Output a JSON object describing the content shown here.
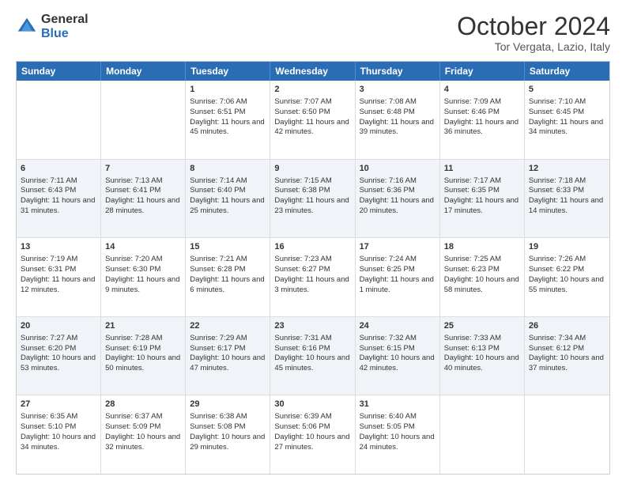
{
  "header": {
    "logo_line1": "General",
    "logo_line2": "Blue",
    "month": "October 2024",
    "location": "Tor Vergata, Lazio, Italy"
  },
  "weekdays": [
    "Sunday",
    "Monday",
    "Tuesday",
    "Wednesday",
    "Thursday",
    "Friday",
    "Saturday"
  ],
  "rows": [
    {
      "alt": false,
      "cells": [
        {
          "day": "",
          "content": ""
        },
        {
          "day": "",
          "content": ""
        },
        {
          "day": "1",
          "content": "Sunrise: 7:06 AM\nSunset: 6:51 PM\nDaylight: 11 hours and 45 minutes."
        },
        {
          "day": "2",
          "content": "Sunrise: 7:07 AM\nSunset: 6:50 PM\nDaylight: 11 hours and 42 minutes."
        },
        {
          "day": "3",
          "content": "Sunrise: 7:08 AM\nSunset: 6:48 PM\nDaylight: 11 hours and 39 minutes."
        },
        {
          "day": "4",
          "content": "Sunrise: 7:09 AM\nSunset: 6:46 PM\nDaylight: 11 hours and 36 minutes."
        },
        {
          "day": "5",
          "content": "Sunrise: 7:10 AM\nSunset: 6:45 PM\nDaylight: 11 hours and 34 minutes."
        }
      ]
    },
    {
      "alt": true,
      "cells": [
        {
          "day": "6",
          "content": "Sunrise: 7:11 AM\nSunset: 6:43 PM\nDaylight: 11 hours and 31 minutes."
        },
        {
          "day": "7",
          "content": "Sunrise: 7:13 AM\nSunset: 6:41 PM\nDaylight: 11 hours and 28 minutes."
        },
        {
          "day": "8",
          "content": "Sunrise: 7:14 AM\nSunset: 6:40 PM\nDaylight: 11 hours and 25 minutes."
        },
        {
          "day": "9",
          "content": "Sunrise: 7:15 AM\nSunset: 6:38 PM\nDaylight: 11 hours and 23 minutes."
        },
        {
          "day": "10",
          "content": "Sunrise: 7:16 AM\nSunset: 6:36 PM\nDaylight: 11 hours and 20 minutes."
        },
        {
          "day": "11",
          "content": "Sunrise: 7:17 AM\nSunset: 6:35 PM\nDaylight: 11 hours and 17 minutes."
        },
        {
          "day": "12",
          "content": "Sunrise: 7:18 AM\nSunset: 6:33 PM\nDaylight: 11 hours and 14 minutes."
        }
      ]
    },
    {
      "alt": false,
      "cells": [
        {
          "day": "13",
          "content": "Sunrise: 7:19 AM\nSunset: 6:31 PM\nDaylight: 11 hours and 12 minutes."
        },
        {
          "day": "14",
          "content": "Sunrise: 7:20 AM\nSunset: 6:30 PM\nDaylight: 11 hours and 9 minutes."
        },
        {
          "day": "15",
          "content": "Sunrise: 7:21 AM\nSunset: 6:28 PM\nDaylight: 11 hours and 6 minutes."
        },
        {
          "day": "16",
          "content": "Sunrise: 7:23 AM\nSunset: 6:27 PM\nDaylight: 11 hours and 3 minutes."
        },
        {
          "day": "17",
          "content": "Sunrise: 7:24 AM\nSunset: 6:25 PM\nDaylight: 11 hours and 1 minute."
        },
        {
          "day": "18",
          "content": "Sunrise: 7:25 AM\nSunset: 6:23 PM\nDaylight: 10 hours and 58 minutes."
        },
        {
          "day": "19",
          "content": "Sunrise: 7:26 AM\nSunset: 6:22 PM\nDaylight: 10 hours and 55 minutes."
        }
      ]
    },
    {
      "alt": true,
      "cells": [
        {
          "day": "20",
          "content": "Sunrise: 7:27 AM\nSunset: 6:20 PM\nDaylight: 10 hours and 53 minutes."
        },
        {
          "day": "21",
          "content": "Sunrise: 7:28 AM\nSunset: 6:19 PM\nDaylight: 10 hours and 50 minutes."
        },
        {
          "day": "22",
          "content": "Sunrise: 7:29 AM\nSunset: 6:17 PM\nDaylight: 10 hours and 47 minutes."
        },
        {
          "day": "23",
          "content": "Sunrise: 7:31 AM\nSunset: 6:16 PM\nDaylight: 10 hours and 45 minutes."
        },
        {
          "day": "24",
          "content": "Sunrise: 7:32 AM\nSunset: 6:15 PM\nDaylight: 10 hours and 42 minutes."
        },
        {
          "day": "25",
          "content": "Sunrise: 7:33 AM\nSunset: 6:13 PM\nDaylight: 10 hours and 40 minutes."
        },
        {
          "day": "26",
          "content": "Sunrise: 7:34 AM\nSunset: 6:12 PM\nDaylight: 10 hours and 37 minutes."
        }
      ]
    },
    {
      "alt": false,
      "cells": [
        {
          "day": "27",
          "content": "Sunrise: 6:35 AM\nSunset: 5:10 PM\nDaylight: 10 hours and 34 minutes."
        },
        {
          "day": "28",
          "content": "Sunrise: 6:37 AM\nSunset: 5:09 PM\nDaylight: 10 hours and 32 minutes."
        },
        {
          "day": "29",
          "content": "Sunrise: 6:38 AM\nSunset: 5:08 PM\nDaylight: 10 hours and 29 minutes."
        },
        {
          "day": "30",
          "content": "Sunrise: 6:39 AM\nSunset: 5:06 PM\nDaylight: 10 hours and 27 minutes."
        },
        {
          "day": "31",
          "content": "Sunrise: 6:40 AM\nSunset: 5:05 PM\nDaylight: 10 hours and 24 minutes."
        },
        {
          "day": "",
          "content": ""
        },
        {
          "day": "",
          "content": ""
        }
      ]
    }
  ]
}
